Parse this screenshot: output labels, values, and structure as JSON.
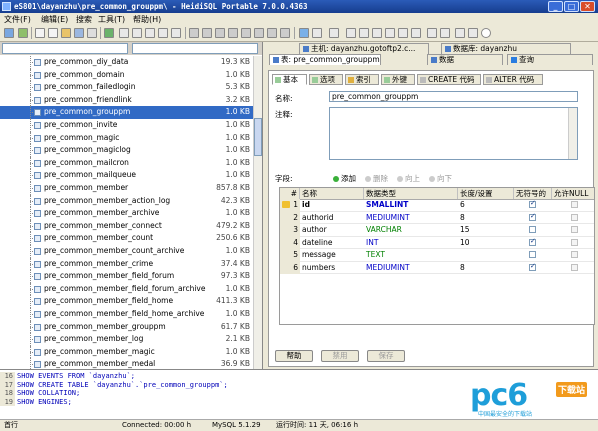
{
  "window": {
    "title": "eS801\\dayanzhu\\pre_common_grouppm\\ - HeidiSQL Portable 7.0.0.4363",
    "min": "_",
    "max": "□",
    "close": "✕"
  },
  "menu": [
    "文件(F)",
    "编辑(E)",
    "搜索",
    "工具(T)",
    "帮助(H)"
  ],
  "tree": {
    "items": [
      {
        "name": "pre_common_diy_data",
        "size": "19.3 KB"
      },
      {
        "name": "pre_common_domain",
        "size": "1.0 KB"
      },
      {
        "name": "pre_common_failedlogin",
        "size": "5.3 KB"
      },
      {
        "name": "pre_common_friendlink",
        "size": "3.2 KB"
      },
      {
        "name": "pre_common_grouppm",
        "size": "1.0 KB",
        "selected": true
      },
      {
        "name": "pre_common_invite",
        "size": "1.0 KB"
      },
      {
        "name": "pre_common_magic",
        "size": "1.0 KB"
      },
      {
        "name": "pre_common_magiclog",
        "size": "1.0 KB"
      },
      {
        "name": "pre_common_mailcron",
        "size": "1.0 KB"
      },
      {
        "name": "pre_common_mailqueue",
        "size": "1.0 KB"
      },
      {
        "name": "pre_common_member",
        "size": "857.8 KB"
      },
      {
        "name": "pre_common_member_action_log",
        "size": "42.3 KB"
      },
      {
        "name": "pre_common_member_archive",
        "size": "1.0 KB"
      },
      {
        "name": "pre_common_member_connect",
        "size": "479.2 KB"
      },
      {
        "name": "pre_common_member_count",
        "size": "250.6 KB"
      },
      {
        "name": "pre_common_member_count_archive",
        "size": "1.0 KB"
      },
      {
        "name": "pre_common_member_crime",
        "size": "37.4 KB"
      },
      {
        "name": "pre_common_member_field_forum",
        "size": "97.3 KB"
      },
      {
        "name": "pre_common_member_field_forum_archive",
        "size": "1.0 KB"
      },
      {
        "name": "pre_common_member_field_home",
        "size": "411.3 KB"
      },
      {
        "name": "pre_common_member_field_home_archive",
        "size": "1.0 KB"
      },
      {
        "name": "pre_common_member_grouppm",
        "size": "61.7 KB"
      },
      {
        "name": "pre_common_member_log",
        "size": "2.1 KB"
      },
      {
        "name": "pre_common_member_magic",
        "size": "1.0 KB"
      },
      {
        "name": "pre_common_member_medal",
        "size": "36.9 KB"
      }
    ]
  },
  "tabs": {
    "host": "主机: dayanzhu.gotoftp2.c...",
    "database": "数据库: dayanzhu",
    "table": "表: pre_common_grouppm",
    "data": "数据",
    "query": "查询"
  },
  "subtabs": [
    "基本",
    "选项",
    "索引",
    "外键",
    "CREATE 代码",
    "ALTER 代码"
  ],
  "form": {
    "name_label": "名称:",
    "name_value": "pre_common_grouppm",
    "comment_label": "注释:"
  },
  "fields_bar": {
    "label": "字段:",
    "add": "添加",
    "delete": "删除",
    "up": "向上",
    "down": "向下"
  },
  "grid": {
    "headers": [
      "#",
      "名称",
      "数据类型",
      "长度/设置",
      "无符号的",
      "允许NULL"
    ],
    "rows": [
      {
        "num": "1",
        "name": "id",
        "type": "SMALLINT",
        "length": "6",
        "unsigned": true,
        "nullable": false,
        "key": true
      },
      {
        "num": "2",
        "name": "authorid",
        "type": "MEDIUMINT",
        "length": "8",
        "unsigned": true,
        "nullable": false
      },
      {
        "num": "3",
        "name": "author",
        "type": "VARCHAR",
        "length": "15",
        "unsigned": false,
        "nullable": false
      },
      {
        "num": "4",
        "name": "dateline",
        "type": "INT",
        "length": "10",
        "unsigned": true,
        "nullable": false
      },
      {
        "num": "5",
        "name": "message",
        "type": "TEXT",
        "length": "",
        "unsigned": false,
        "nullable": false
      },
      {
        "num": "6",
        "name": "numbers",
        "type": "MEDIUMINT",
        "length": "8",
        "unsigned": true,
        "nullable": false
      }
    ]
  },
  "buttons": {
    "help": "帮助",
    "discard": "禁用",
    "save": "保存"
  },
  "sql_log": [
    {
      "n": "16",
      "text": "SHOW EVENTS FROM `dayanzhu`;"
    },
    {
      "n": "17",
      "text": "SHOW CREATE TABLE `dayanzhu`.`pre_common_grouppm`;"
    },
    {
      "n": "18",
      "text": "SHOW COLLATION;"
    },
    {
      "n": "19",
      "text": "SHOW ENGINES;"
    }
  ],
  "status": {
    "line": "首行",
    "connected": "Connected: 00:00 h",
    "version": "MySQL 5.1.29",
    "uptime": "运行时间: 11 天, 06:16 h"
  },
  "watermark": {
    "brand": "pc6",
    "badge": "下载站",
    "sub": "中国最安全的下载站"
  },
  "colors": {
    "titlebar": "#163d8e",
    "selection": "#316ac5",
    "type_numeric": "#0000c8",
    "type_text": "#008000",
    "watermark": "#1e9ed9"
  }
}
